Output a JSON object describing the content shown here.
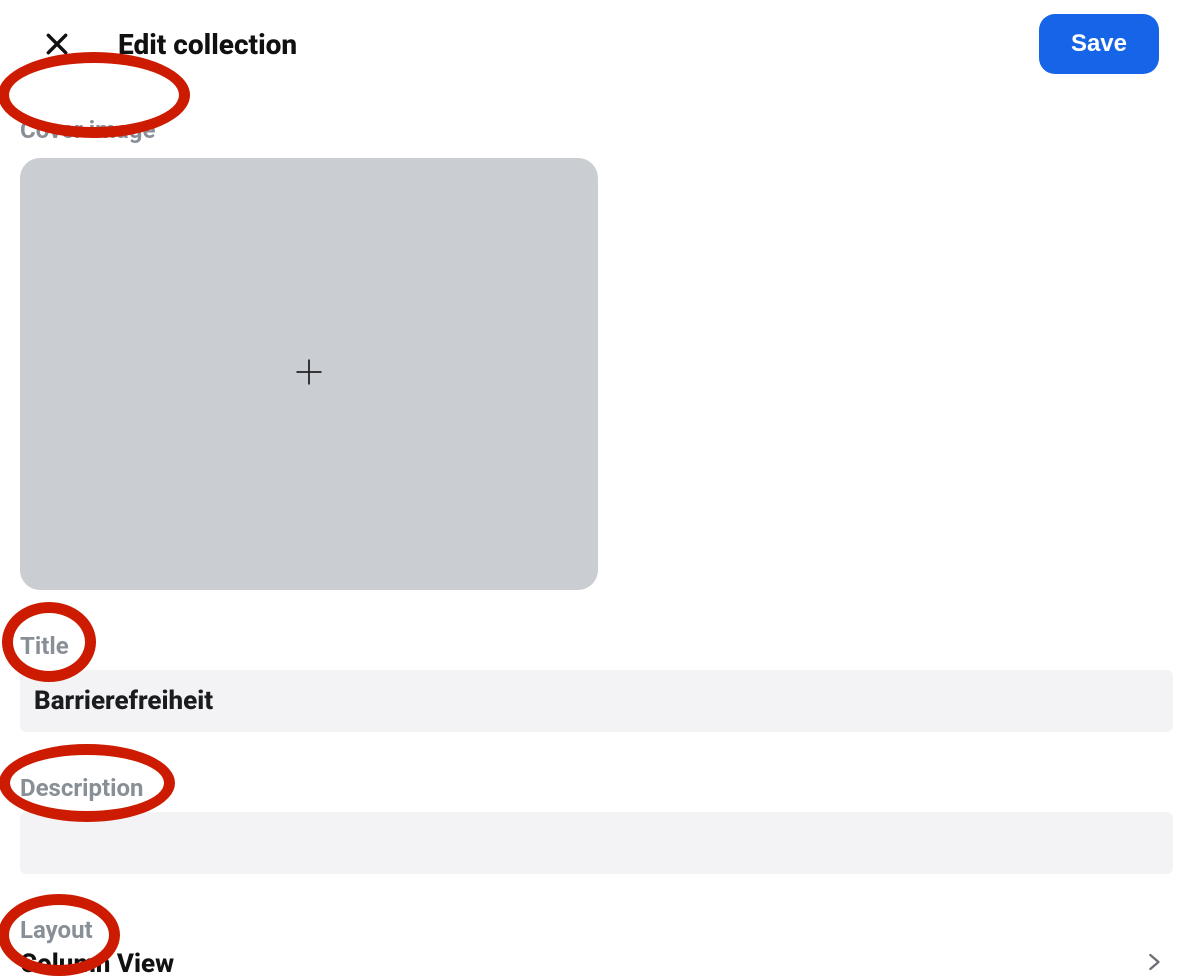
{
  "header": {
    "title": "Edit collection",
    "save_label": "Save"
  },
  "sections": {
    "cover_image_label": "Cover image",
    "title_label": "Title",
    "title_value": "Barrierefreiheit",
    "description_label": "Description",
    "description_value": "",
    "layout_label": "Layout",
    "layout_value": "Column View"
  },
  "icons": {
    "close": "close-icon",
    "plus": "plus-icon",
    "chevron_right": "chevron-right-icon"
  },
  "annotations": {
    "highlighted_labels": [
      "cover_image",
      "title",
      "description",
      "layout"
    ]
  }
}
